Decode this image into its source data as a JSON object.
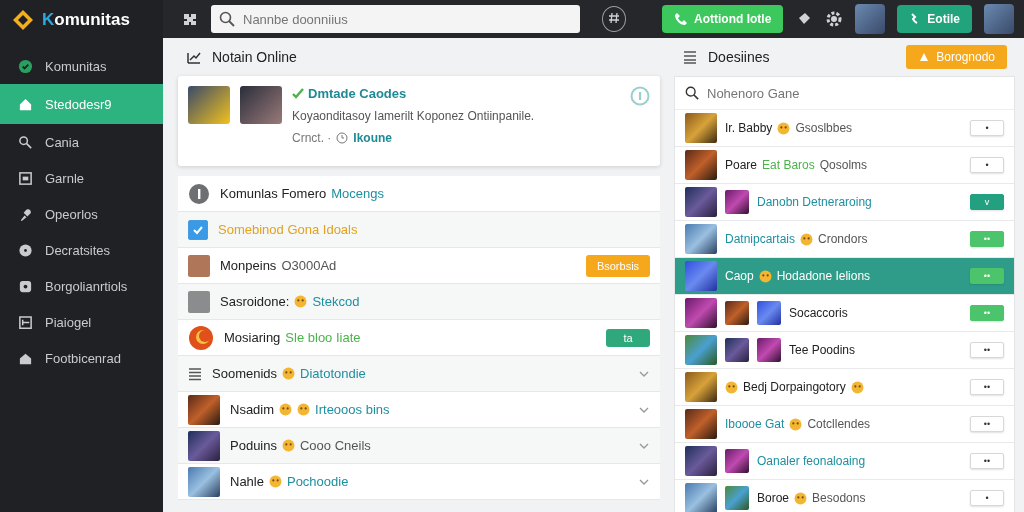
{
  "sidebar": {
    "logo": "Komunitas",
    "items": [
      {
        "label": "Komunitas",
        "selected": false
      },
      {
        "label": "Stedodesr9",
        "selected": true
      },
      {
        "label": "Cania",
        "selected": false
      },
      {
        "label": "Garnle",
        "selected": false
      },
      {
        "label": "Opeorlos",
        "selected": false
      },
      {
        "label": "Decratsites",
        "selected": false
      },
      {
        "label": "Borgolianrtiols",
        "selected": false
      },
      {
        "label": "Piaiogel",
        "selected": false
      },
      {
        "label": "Footbicenrad",
        "selected": false
      }
    ]
  },
  "topbar": {
    "search": {
      "placeholder": "Nannbe doonniius"
    },
    "call_button": "Aottiond Iotle",
    "teal_button": "Eotile"
  },
  "online": {
    "title": "Notain Online",
    "card": {
      "title": "Dmtade Caodes",
      "text": "Koyaonditasoy Iamerilt Koponez Ontiinpanile.",
      "meta": "Crnct. ·",
      "link": "Ikoune"
    },
    "rows": [
      {
        "kind": "info",
        "segments": [
          {
            "kind": "text",
            "text": "Komunlas Fomero",
            "color": "#222222"
          },
          {
            "kind": "text",
            "text": "Mocengs",
            "color": "#1d8fa0"
          }
        ]
      },
      {
        "kind": "check",
        "checked": true,
        "segments": [
          {
            "kind": "text",
            "text": "Somebinod Gona Idoals",
            "color": "#e2a21c"
          }
        ]
      },
      {
        "kind": "tile",
        "segments": [
          {
            "kind": "text",
            "text": "Monpeins",
            "color": "#222222"
          },
          {
            "kind": "text",
            "text": "O3000Ad",
            "color": "#555555"
          }
        ],
        "button": {
          "text": "Bsorbsis",
          "kind": "orange"
        }
      },
      {
        "kind": "tile",
        "segments": [
          {
            "kind": "text",
            "text": "Sasroidone:",
            "color": "#222222"
          },
          {
            "kind": "icon"
          },
          {
            "kind": "text",
            "text": "Stekcod",
            "color": "#1d8fa0"
          }
        ]
      },
      {
        "kind": "logo",
        "segments": [
          {
            "kind": "text",
            "text": "Mosiaring",
            "color": "#222222"
          },
          {
            "kind": "text",
            "text": "Sle bloo Iiate",
            "color": "#4ab34a"
          }
        ],
        "button": {
          "text": "ta",
          "kind": "green"
        }
      },
      {
        "kind": "list",
        "expanded": false,
        "segments": [
          {
            "kind": "text",
            "text": "Soomenids",
            "color": "#222222"
          },
          {
            "kind": "icon"
          },
          {
            "kind": "text",
            "text": "Diatotondie",
            "color": "#1d8fa0"
          }
        ]
      },
      {
        "kind": "thumb",
        "expanded": false,
        "segments": [
          {
            "kind": "text",
            "text": "Nsadim",
            "color": "#222222"
          },
          {
            "kind": "icon"
          },
          {
            "kind": "icon"
          },
          {
            "kind": "text",
            "text": "Irteooos bins",
            "color": "#1d8fa0"
          }
        ]
      },
      {
        "kind": "thumb",
        "expanded": false,
        "segments": [
          {
            "kind": "text",
            "text": "Poduins",
            "color": "#222222"
          },
          {
            "kind": "icon"
          },
          {
            "kind": "text",
            "text": "Cooo Cneils",
            "color": "#555555"
          }
        ]
      },
      {
        "kind": "thumb",
        "expanded": false,
        "segments": [
          {
            "kind": "text",
            "text": "Nahle",
            "color": "#222222"
          },
          {
            "kind": "icon"
          },
          {
            "kind": "text",
            "text": "Pochoodie",
            "color": "#1d8fa0"
          }
        ]
      }
    ]
  },
  "games": {
    "title": "Doesiines",
    "button": "Borognodo",
    "search": {
      "placeholder": "Nohenoro Gane"
    },
    "rows": [
      {
        "selected": false,
        "thumbs": [
          {
            "kind": "image"
          }
        ],
        "segments": [
          {
            "kind": "text",
            "text": "Ir. Babby",
            "color": "#222222"
          },
          {
            "kind": "icon"
          },
          {
            "kind": "text",
            "text": "Gsoslbbes",
            "color": "#555555"
          }
        ],
        "button": {
          "text": "•",
          "kind": "plain"
        }
      },
      {
        "selected": false,
        "thumbs": [
          {
            "kind": "image"
          }
        ],
        "segments": [
          {
            "kind": "text",
            "text": "Poare",
            "color": "#222222"
          },
          {
            "kind": "text",
            "text": "Eat Baros",
            "color": "#4ab34a"
          },
          {
            "kind": "text",
            "text": "Qosolms",
            "color": "#555555"
          }
        ],
        "button": {
          "text": "•",
          "kind": "plain"
        }
      },
      {
        "selected": false,
        "thumbs": [
          {
            "kind": "image"
          },
          {
            "kind": "image"
          }
        ],
        "segments": [
          {
            "kind": "text",
            "text": "Danobn Detneraroing",
            "color": "#1d8fa0"
          }
        ],
        "button": {
          "text": "v",
          "kind": "teal"
        }
      },
      {
        "selected": false,
        "thumbs": [
          {
            "kind": "image"
          }
        ],
        "segments": [
          {
            "kind": "text",
            "text": "Datnipcartais",
            "color": "#1d8fa0"
          },
          {
            "kind": "icon"
          },
          {
            "kind": "text",
            "text": "Crondors",
            "color": "#555555"
          }
        ],
        "button": {
          "text": "••",
          "kind": "green"
        }
      },
      {
        "selected": true,
        "thumbs": [
          {
            "kind": "image"
          }
        ],
        "segments": [
          {
            "kind": "text",
            "text": "Caop",
            "color": "#ffffff"
          },
          {
            "kind": "icon"
          },
          {
            "kind": "text",
            "text": "Hodadone Ielions",
            "color": "#ffffff"
          }
        ],
        "button": {
          "text": "••",
          "kind": "green"
        }
      },
      {
        "selected": false,
        "thumbs": [
          {
            "kind": "image"
          },
          {
            "kind": "image"
          },
          {
            "kind": "image"
          }
        ],
        "segments": [
          {
            "kind": "text",
            "text": "Socaccoris",
            "color": "#222222"
          }
        ],
        "button": {
          "text": "••",
          "kind": "green"
        }
      },
      {
        "selected": false,
        "thumbs": [
          {
            "kind": "image"
          },
          {
            "kind": "image"
          },
          {
            "kind": "image"
          }
        ],
        "segments": [
          {
            "kind": "text",
            "text": "Tee Poodins",
            "color": "#222222"
          }
        ],
        "button": {
          "text": "••",
          "kind": "plain"
        }
      },
      {
        "selected": false,
        "thumbs": [
          {
            "kind": "image"
          }
        ],
        "segments": [
          {
            "kind": "icon"
          },
          {
            "kind": "text",
            "text": "Bedj Dorpaingotory",
            "color": "#222222"
          },
          {
            "kind": "icon"
          }
        ],
        "button": {
          "text": "••",
          "kind": "plain"
        }
      },
      {
        "selected": false,
        "thumbs": [
          {
            "kind": "image"
          }
        ],
        "segments": [
          {
            "kind": "text",
            "text": "Iboooe Gat",
            "color": "#1d8fa0"
          },
          {
            "kind": "icon"
          },
          {
            "kind": "text",
            "text": "Cotcllendes",
            "color": "#555555"
          }
        ],
        "button": {
          "text": "••",
          "kind": "plain"
        }
      },
      {
        "selected": false,
        "thumbs": [
          {
            "kind": "image"
          },
          {
            "kind": "image"
          }
        ],
        "segments": [
          {
            "kind": "text",
            "text": "Oanaler feonaloaing",
            "color": "#1d8fa0"
          }
        ],
        "button": {
          "text": "••",
          "kind": "plain"
        }
      },
      {
        "selected": false,
        "thumbs": [
          {
            "kind": "image"
          },
          {
            "kind": "image"
          }
        ],
        "segments": [
          {
            "kind": "text",
            "text": "Boroe",
            "color": "#222222"
          },
          {
            "kind": "icon"
          },
          {
            "kind": "text",
            "text": "Besodons",
            "color": "#555555"
          }
        ],
        "button": {
          "text": "•",
          "kind": "plain"
        }
      }
    ]
  }
}
